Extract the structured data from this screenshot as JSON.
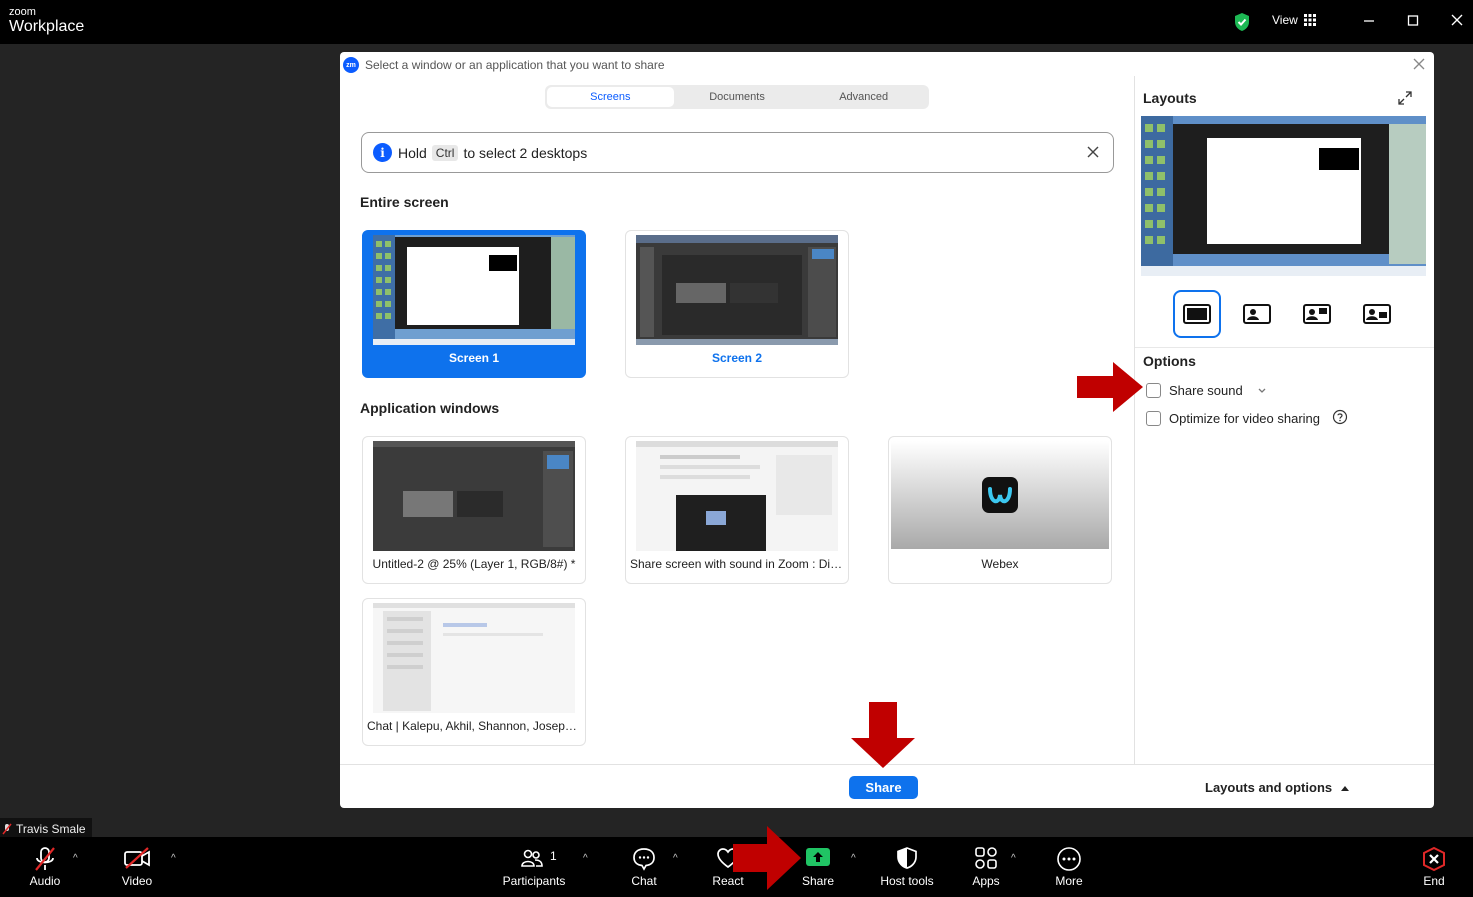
{
  "app": {
    "brand_small": "zoom",
    "brand_big": "Workplace",
    "view_label": "View"
  },
  "dialog": {
    "title": "Select a window or an application that you want to share",
    "tabs": [
      "Screens",
      "Documents",
      "Advanced"
    ],
    "hint": {
      "prefix": "Hold",
      "key": "Ctrl",
      "suffix": "to select 2 desktops"
    },
    "entire_screen_heading": "Entire screen",
    "screens": [
      "Screen 1",
      "Screen 2"
    ],
    "app_windows_heading": "Application windows",
    "windows": [
      "Untitled-2 @ 25% (Layer 1, RGB/8#) *",
      "Share screen with sound in Zoom : Divi...",
      "Webex",
      "Chat | Kalepu, Akhil, Shannon, Joseph P..."
    ],
    "share_button": "Share",
    "layouts_and_options": "Layouts and options"
  },
  "side_panel": {
    "layouts_heading": "Layouts",
    "options_heading": "Options",
    "share_sound": "Share sound",
    "optimize_video": "Optimize for video sharing"
  },
  "meeting": {
    "participant_name": "Travis Smale",
    "participant_count": "1",
    "toolbar": {
      "audio": "Audio",
      "video": "Video",
      "participants": "Participants",
      "chat": "Chat",
      "react": "React",
      "share": "Share",
      "host_tools": "Host tools",
      "apps": "Apps",
      "more": "More",
      "end": "End"
    }
  },
  "colors": {
    "accent": "#0e72ed",
    "share_green": "#20c464",
    "annotation_red": "#c00000",
    "end_red": "#e02828"
  }
}
